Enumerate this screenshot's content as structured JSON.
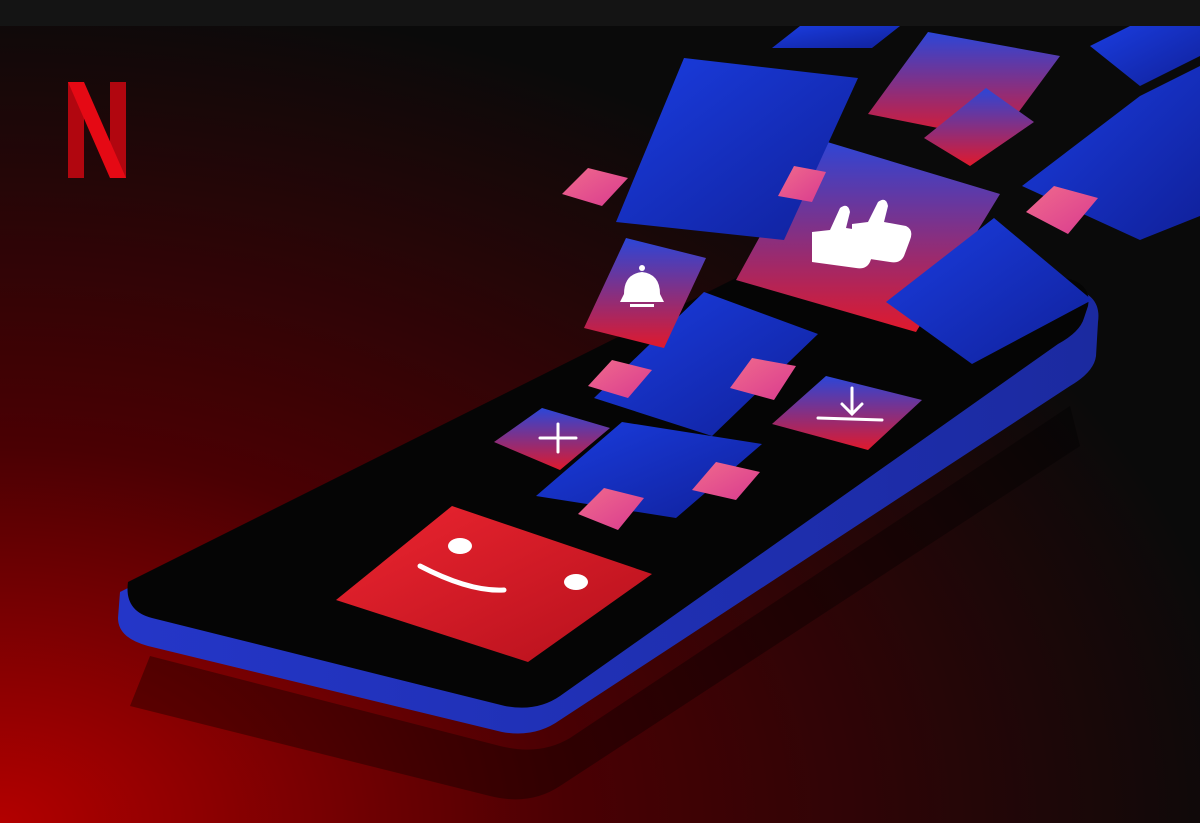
{
  "brand": {
    "logo_icon": "netflix-n-logo-icon",
    "logo_color": "#e50914"
  },
  "colors": {
    "background_dark": "#0b0b0b",
    "background_red": "#a00000",
    "phone_body": "#1f2fb8",
    "phone_screen": "#050505",
    "tile_blue": "#1d3fd6",
    "tile_red": "#e1162a",
    "tile_pink": "#e86a9c",
    "smiley_tile": "#d81823"
  },
  "icons": {
    "smiley": "smiley-face-icon",
    "thumbs_up": "double-thumbs-up-icon",
    "bell": "bell-icon",
    "add": "plus-icon",
    "download": "download-icon"
  }
}
